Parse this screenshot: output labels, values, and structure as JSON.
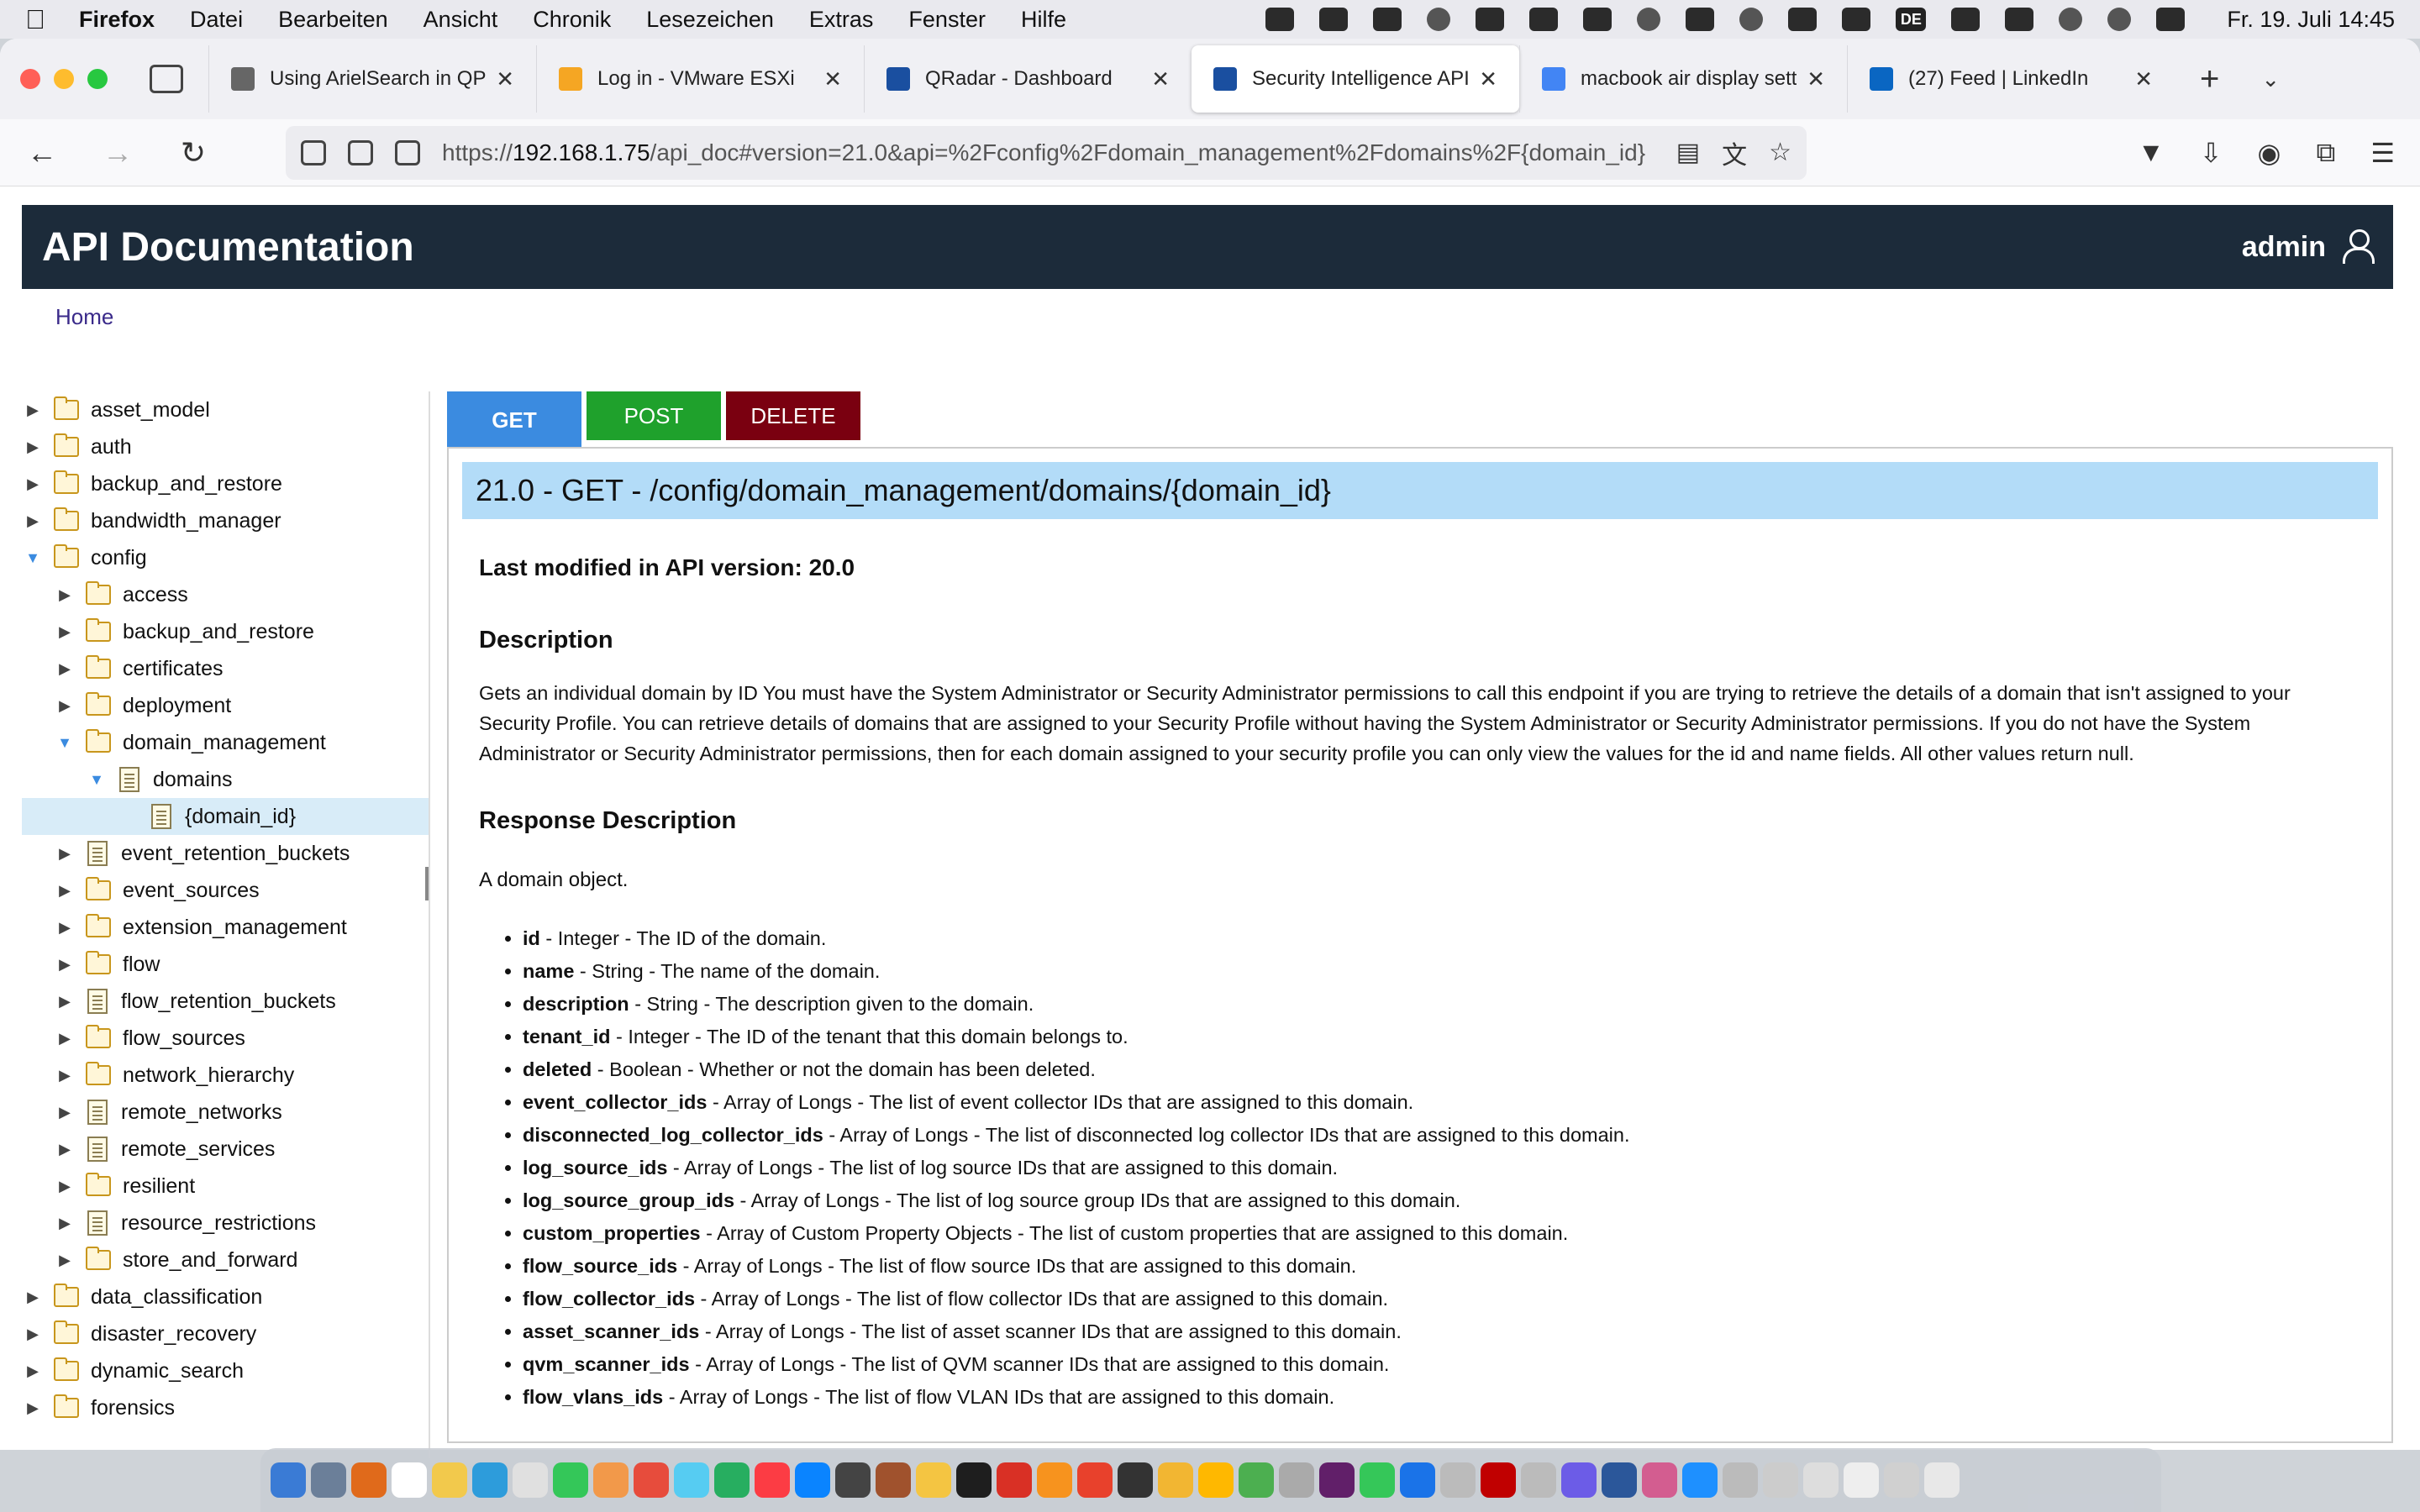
{
  "menubar": {
    "app": "Firefox",
    "items": [
      "Datei",
      "Bearbeiten",
      "Ansicht",
      "Chronik",
      "Lesezeichen",
      "Extras",
      "Fenster",
      "Hilfe"
    ],
    "clock": "Fr. 19. Juli  14:45",
    "input_source": "DE"
  },
  "tabs": [
    {
      "label": "Using ArielSearch in QPYL",
      "icon": "ariel-icon",
      "color": "#666666"
    },
    {
      "label": "Log in - VMware ESXi",
      "icon": "vmware-icon",
      "color": "#f5a623"
    },
    {
      "label": "QRadar - Dashboard",
      "icon": "qradar-icon",
      "color": "#1a4fa0"
    },
    {
      "label": "Security Intelligence API",
      "icon": "qradar-icon",
      "color": "#1a4fa0",
      "active": true
    },
    {
      "label": "macbook air display settin",
      "icon": "google-icon",
      "color": "#4285f4"
    },
    {
      "label": "(27) Feed | LinkedIn",
      "icon": "linkedin-icon",
      "color": "#0a66c2"
    }
  ],
  "url": {
    "prefix": "https://",
    "host": "192.168.1.75",
    "path": "/api_doc#version=21.0&api=%2Fconfig%2Fdomain_management%2Fdomains%2F{domain_id}"
  },
  "page": {
    "header_title": "API Documentation",
    "user": "admin",
    "breadcrumb_home": "Home"
  },
  "tree": [
    {
      "label": "asset_model",
      "level": 0,
      "type": "folder",
      "expanded": false
    },
    {
      "label": "auth",
      "level": 0,
      "type": "folder",
      "expanded": false
    },
    {
      "label": "backup_and_restore",
      "level": 0,
      "type": "folder",
      "expanded": false
    },
    {
      "label": "bandwidth_manager",
      "level": 0,
      "type": "folder",
      "expanded": false
    },
    {
      "label": "config",
      "level": 0,
      "type": "folder",
      "expanded": true
    },
    {
      "label": "access",
      "level": 1,
      "type": "folder",
      "expanded": false
    },
    {
      "label": "backup_and_restore",
      "level": 1,
      "type": "folder",
      "expanded": false
    },
    {
      "label": "certificates",
      "level": 1,
      "type": "folder",
      "expanded": false
    },
    {
      "label": "deployment",
      "level": 1,
      "type": "folder",
      "expanded": false
    },
    {
      "label": "domain_management",
      "level": 1,
      "type": "folder",
      "expanded": true
    },
    {
      "label": "domains",
      "level": 2,
      "type": "doc",
      "expanded": true
    },
    {
      "label": "{domain_id}",
      "level": 3,
      "type": "doc",
      "leaf": true,
      "selected": true
    },
    {
      "label": "event_retention_buckets",
      "level": 1,
      "type": "doc",
      "expanded": false
    },
    {
      "label": "event_sources",
      "level": 1,
      "type": "folder",
      "expanded": false
    },
    {
      "label": "extension_management",
      "level": 1,
      "type": "folder",
      "expanded": false
    },
    {
      "label": "flow",
      "level": 1,
      "type": "folder",
      "expanded": false
    },
    {
      "label": "flow_retention_buckets",
      "level": 1,
      "type": "doc",
      "expanded": false
    },
    {
      "label": "flow_sources",
      "level": 1,
      "type": "folder",
      "expanded": false
    },
    {
      "label": "network_hierarchy",
      "level": 1,
      "type": "folder",
      "expanded": false
    },
    {
      "label": "remote_networks",
      "level": 1,
      "type": "doc",
      "expanded": false
    },
    {
      "label": "remote_services",
      "level": 1,
      "type": "doc",
      "expanded": false
    },
    {
      "label": "resilient",
      "level": 1,
      "type": "folder",
      "expanded": false
    },
    {
      "label": "resource_restrictions",
      "level": 1,
      "type": "doc",
      "expanded": false
    },
    {
      "label": "store_and_forward",
      "level": 1,
      "type": "folder",
      "expanded": false
    },
    {
      "label": "data_classification",
      "level": 0,
      "type": "folder",
      "expanded": false
    },
    {
      "label": "disaster_recovery",
      "level": 0,
      "type": "folder",
      "expanded": false
    },
    {
      "label": "dynamic_search",
      "level": 0,
      "type": "folder",
      "expanded": false
    },
    {
      "label": "forensics",
      "level": 0,
      "type": "folder",
      "expanded": false
    }
  ],
  "methods": {
    "get": "GET",
    "post": "POST",
    "delete": "DELETE"
  },
  "endpoint": "21.0 - GET - /config/domain_management/domains/{domain_id}",
  "last_modified": "Last modified in API version: 20.0",
  "description_heading": "Description",
  "description": "Gets an individual domain by ID You must have the System Administrator or Security Administrator permissions to call this endpoint if you are trying to retrieve the details of a domain that isn't assigned to your Security Profile. You can retrieve details of domains that are assigned to your Security Profile without having the System Administrator or Security Administrator permissions.  If you do not have the System Administrator or Security Administrator permissions, then for each domain assigned to your security profile you can only view the values for the id and name fields. All other values return null.",
  "response_heading": "Response Description",
  "response_text": "A domain object.",
  "fields": [
    {
      "name": "id",
      "text": " - Integer - The ID of the domain."
    },
    {
      "name": "name",
      "text": " - String - The name of the domain."
    },
    {
      "name": "description",
      "text": " - String - The description given to the domain."
    },
    {
      "name": "tenant_id",
      "text": " - Integer - The ID of the tenant that this domain belongs to."
    },
    {
      "name": "deleted",
      "text": " - Boolean - Whether or not the domain has been deleted."
    },
    {
      "name": "event_collector_ids",
      "text": " - Array of Longs - The list of event collector IDs that are assigned to this domain."
    },
    {
      "name": "disconnected_log_collector_ids",
      "text": " - Array of Longs - The list of disconnected log collector IDs that are assigned to this domain."
    },
    {
      "name": "log_source_ids",
      "text": " - Array of Longs - The list of log source IDs that are assigned to this domain."
    },
    {
      "name": "log_source_group_ids",
      "text": " - Array of Longs - The list of log source group IDs that are assigned to this domain."
    },
    {
      "name": "custom_properties",
      "text": " - Array of Custom Property Objects - The list of custom properties that are assigned to this domain."
    },
    {
      "name": "flow_source_ids",
      "text": " - Array of Longs - The list of flow source IDs that are assigned to this domain."
    },
    {
      "name": "flow_collector_ids",
      "text": " - Array of Longs - The list of flow collector IDs that are assigned to this domain."
    },
    {
      "name": "asset_scanner_ids",
      "text": " - Array of Longs - The list of asset scanner IDs that are assigned to this domain."
    },
    {
      "name": "qvm_scanner_ids",
      "text": " - Array of Longs - The list of QVM scanner IDs that are assigned to this domain."
    },
    {
      "name": "flow_vlans_ids",
      "text": " - Array of Longs - The list of flow VLAN IDs that are assigned to this domain."
    }
  ],
  "dock_colors": [
    "#3a7bd5",
    "#6b7f99",
    "#e06a1b",
    "#ffffff",
    "#f2c94c",
    "#2d9cdb",
    "#e0e0e0",
    "#34c759",
    "#f2994a",
    "#e74c3c",
    "#56ccf2",
    "#27ae60",
    "#fc3c44",
    "#0a84ff",
    "#444444",
    "#a0522d",
    "#f4c542",
    "#1e1e1e",
    "#d93025",
    "#f7931e",
    "#e8412c",
    "#333333",
    "#f2b632",
    "#ffb800",
    "#4caf50",
    "#aaaaaa",
    "#611f69",
    "#35c759",
    "#1a73e8",
    "#bbbbbb",
    "#c00000",
    "#bbbbbb",
    "#6c5ce7",
    "#2b579a",
    "#d35d90",
    "#1e90ff",
    "#bbbbbb",
    "#cccccc",
    "#dddddd",
    "#eeeeee",
    "#d0d0d0",
    "#e8e8e8"
  ]
}
